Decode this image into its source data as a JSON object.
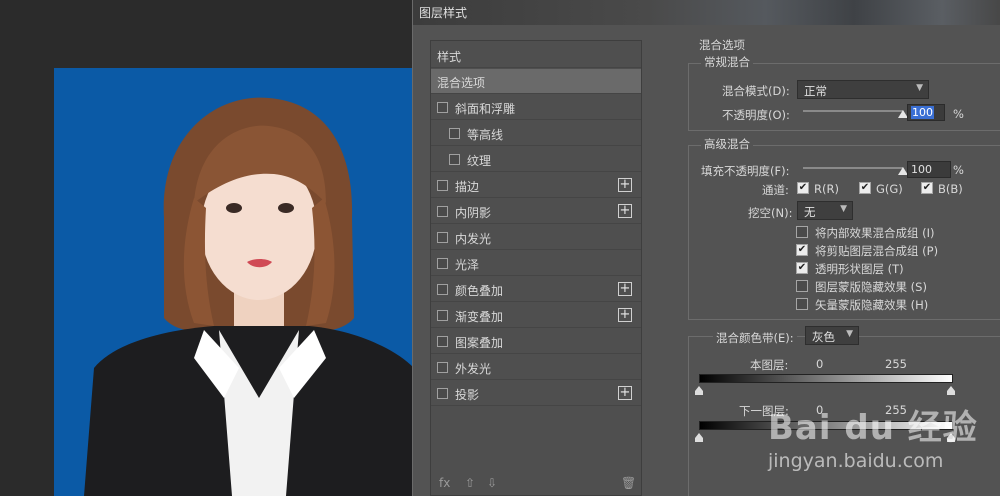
{
  "dialog": {
    "title": "图层样式"
  },
  "styles_list": {
    "items": [
      {
        "label": "样式",
        "checkbox": false,
        "plus": false,
        "indent": false,
        "selected": false
      },
      {
        "label": "混合选项",
        "checkbox": false,
        "plus": false,
        "indent": false,
        "selected": true
      },
      {
        "label": "斜面和浮雕",
        "checkbox": true,
        "plus": false,
        "indent": false,
        "selected": false
      },
      {
        "label": "等高线",
        "checkbox": true,
        "plus": false,
        "indent": true,
        "selected": false
      },
      {
        "label": "纹理",
        "checkbox": true,
        "plus": false,
        "indent": true,
        "selected": false
      },
      {
        "label": "描边",
        "checkbox": true,
        "plus": true,
        "indent": false,
        "selected": false
      },
      {
        "label": "内阴影",
        "checkbox": true,
        "plus": true,
        "indent": false,
        "selected": false
      },
      {
        "label": "内发光",
        "checkbox": true,
        "plus": false,
        "indent": false,
        "selected": false
      },
      {
        "label": "光泽",
        "checkbox": true,
        "plus": false,
        "indent": false,
        "selected": false
      },
      {
        "label": "颜色叠加",
        "checkbox": true,
        "plus": true,
        "indent": false,
        "selected": false
      },
      {
        "label": "渐变叠加",
        "checkbox": true,
        "plus": true,
        "indent": false,
        "selected": false
      },
      {
        "label": "图案叠加",
        "checkbox": true,
        "plus": false,
        "indent": false,
        "selected": false
      },
      {
        "label": "外发光",
        "checkbox": true,
        "plus": false,
        "indent": false,
        "selected": false
      },
      {
        "label": "投影",
        "checkbox": true,
        "plus": true,
        "indent": false,
        "selected": false
      }
    ],
    "footer": {
      "fx": "fx",
      "up": "⇧",
      "down": "⇩",
      "trash": "🗑"
    }
  },
  "blending": {
    "section_title": "混合选项",
    "general": {
      "title": "常规混合",
      "mode_label": "混合模式(D):",
      "mode_value": "正常",
      "opacity_label": "不透明度(O):",
      "opacity_value": "100",
      "opacity_fraction": 1.0,
      "unit": "%"
    },
    "advanced": {
      "title": "高级混合",
      "fill_label": "填充不透明度(F):",
      "fill_value": "100",
      "fill_fraction": 1.0,
      "unit": "%",
      "channels_label": "通道:",
      "channels": [
        {
          "label": "R(R)",
          "checked": true
        },
        {
          "label": "G(G)",
          "checked": true
        },
        {
          "label": "B(B)",
          "checked": true
        }
      ],
      "knockout_label": "挖空(N):",
      "knockout_value": "无",
      "options": [
        {
          "label": "将内部效果混合成组 (I)",
          "checked": false
        },
        {
          "label": "将剪贴图层混合成组 (P)",
          "checked": true
        },
        {
          "label": "透明形状图层 (T)",
          "checked": true
        },
        {
          "label": "图层蒙版隐藏效果 (S)",
          "checked": false
        },
        {
          "label": "矢量蒙版隐藏效果 (H)",
          "checked": false
        }
      ]
    },
    "blend_if": {
      "label": "混合颜色带(E):",
      "value": "灰色",
      "this_layer_label": "本图层:",
      "this_min": "0",
      "this_max": "255",
      "underlying_label": "下一图层:",
      "under_min": "0",
      "under_max": "255"
    }
  },
  "watermark": {
    "logo": "Bai du 经验",
    "url": "jingyan.baidu.com"
  },
  "colors": {
    "photo_bg": "#0b5aa6",
    "selected_row": "#6a6a6a",
    "highlight": "#3a6fd4"
  }
}
